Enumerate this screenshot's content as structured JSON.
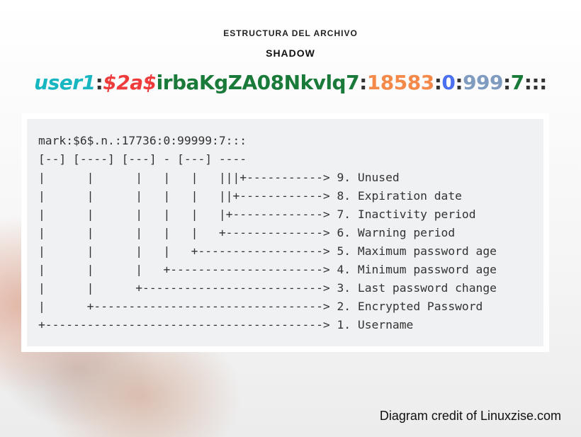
{
  "header": {
    "line1": "ESTRUCTURA DEL ARCHIVO",
    "line2": "SHADOW"
  },
  "shadow_example": {
    "segments": [
      {
        "text": "user1",
        "color": "#17b6c1",
        "italic": true
      },
      {
        "text": ":",
        "color": "#333333"
      },
      {
        "text": "$2a$",
        "color": "#ef3b3b",
        "italic": true
      },
      {
        "text": "irbaKgZA08Nkvlq7",
        "color": "#1a7a3a"
      },
      {
        "text": ":",
        "color": "#333333"
      },
      {
        "text": "18583",
        "color": "#f5894a"
      },
      {
        "text": ":",
        "color": "#333333"
      },
      {
        "text": "0",
        "color": "#4a6ff0"
      },
      {
        "text": ":",
        "color": "#333333"
      },
      {
        "text": "999",
        "color": "#7f9bc0"
      },
      {
        "text": ":",
        "color": "#333333"
      },
      {
        "text": "7",
        "color": "#1a7a3a"
      },
      {
        "text": ":::",
        "color": "#333333"
      }
    ]
  },
  "diagram": {
    "lines": [
      "mark:$6$.n.:17736:0:99999:7:::",
      "[--] [----] [---] - [---] ----",
      "|      |      |   |   |   |||+-----------> 9. Unused",
      "|      |      |   |   |   ||+------------> 8. Expiration date",
      "|      |      |   |   |   |+-------------> 7. Inactivity period",
      "|      |      |   |   |   +--------------> 6. Warning period",
      "|      |      |   |   +------------------> 5. Maximum password age",
      "|      |      |   +----------------------> 4. Minimum password age",
      "|      |      +--------------------------> 3. Last password change",
      "|      +---------------------------------> 2. Encrypted Password",
      "+----------------------------------------> 1. Username"
    ]
  },
  "credit": "Diagram credit of Linuxzise.com"
}
